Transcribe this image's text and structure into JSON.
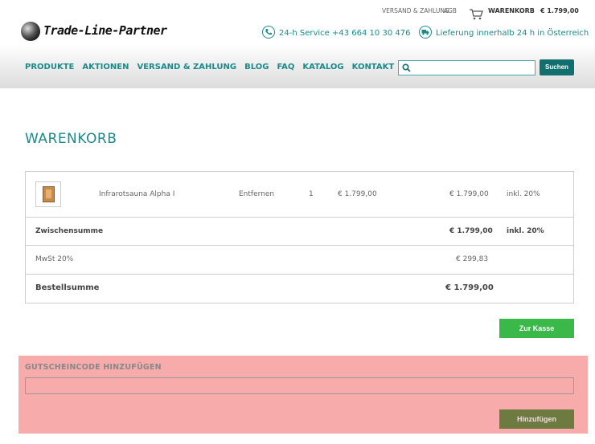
{
  "toplinks": {
    "versand": "VERSAND & ZAHLUNG",
    "agb": "AGB",
    "cart": "WARENKORB",
    "cart_total": "€ 1.799,00"
  },
  "logo": {
    "text": "Trade-Line-Partner"
  },
  "service": {
    "label": "24-h Service",
    "phone": "+43 664 10 30 476"
  },
  "delivery": {
    "label": "Lieferung innerhalb 24 h in Österreich"
  },
  "nav": {
    "items": [
      "PRODUKTE",
      "AKTIONEN",
      "VERSAND & ZAHLUNG",
      "BLOG",
      "FAQ",
      "KATALOG",
      "KONTAKT"
    ]
  },
  "search": {
    "value": "",
    "placeholder": "",
    "button": "Suchen"
  },
  "page": {
    "title": "WARENKORB"
  },
  "cart": {
    "item": {
      "name": "Infrarotsauna Alpha I",
      "remove": "Entfernen",
      "quantity": "1",
      "unit_price": "€ 1.799,00",
      "total": "€ 1.799,00",
      "tax": "inkl. 20%"
    },
    "subtotal": {
      "label": "Zwischensumme",
      "value": "€ 1.799,00",
      "tax": "inkl. 20%"
    },
    "vat": {
      "label": "MwSt 20%",
      "value": "€ 299,83"
    },
    "order_total": {
      "label": "Bestellsumme",
      "value": "€ 1.799,00"
    }
  },
  "checkout_button": "Zur Kasse",
  "coupon": {
    "title": "GUTSCHEINCODE HINZUFÜGEN",
    "value": "",
    "button": "Hinzufügen"
  },
  "colors": {
    "accent": "#1a8a8a",
    "checkout": "#3bb84a",
    "coupon_bg": "#f7abab",
    "coupon_button": "#6d7a40"
  },
  "icons": [
    "cart-icon",
    "phone-icon",
    "truck-icon",
    "search-icon"
  ]
}
